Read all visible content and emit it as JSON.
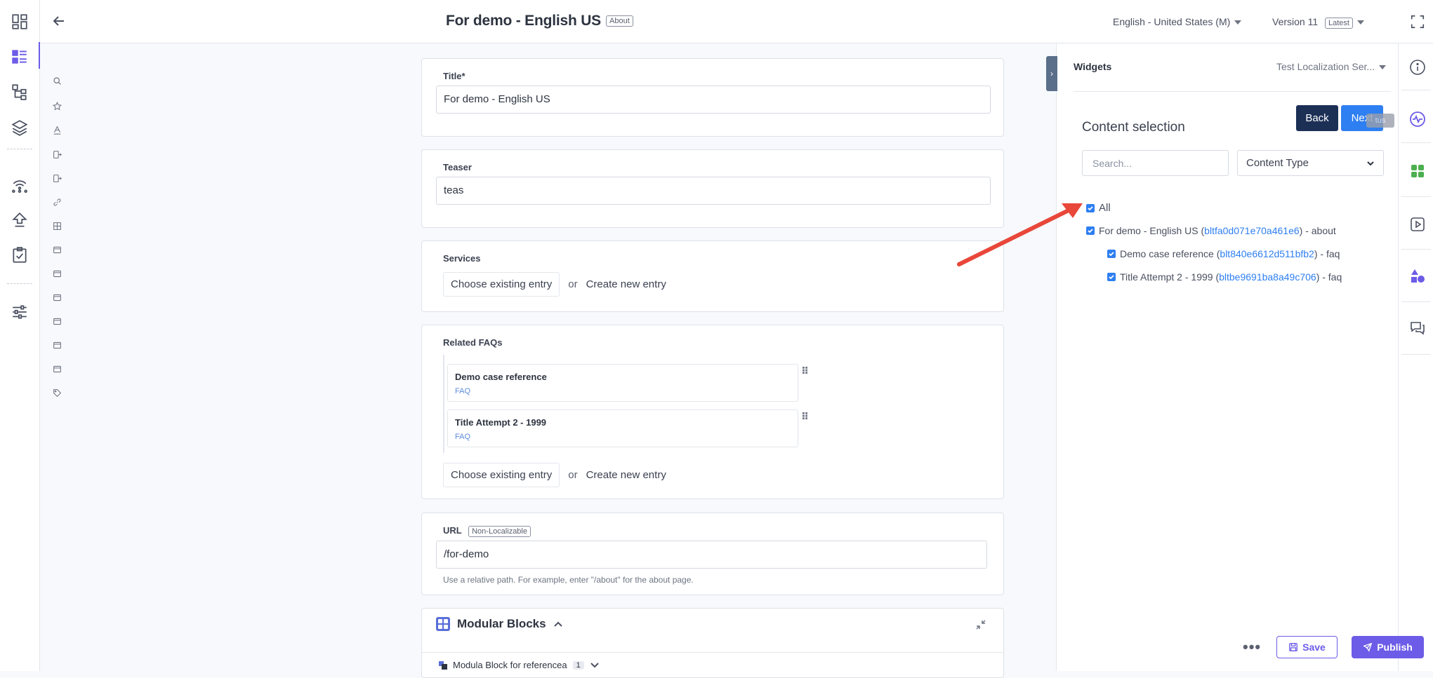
{
  "header": {
    "title": "For demo - English US",
    "title_badge": "About",
    "locale": "English - United States (M)",
    "version": "Version 11",
    "version_badge": "Latest"
  },
  "form": {
    "title": {
      "label": "Title*",
      "value": "For demo - English US"
    },
    "teaser": {
      "label": "Teaser",
      "value": "teas"
    },
    "services": {
      "label": "Services",
      "choose": "Choose existing entry",
      "or": "or",
      "create": "Create new entry"
    },
    "related_faqs": {
      "label": "Related FAQs",
      "items": [
        {
          "title": "Demo case reference",
          "type": "FAQ"
        },
        {
          "title": "Title Attempt 2 - 1999",
          "type": "FAQ"
        }
      ],
      "choose": "Choose existing entry",
      "or": "or",
      "create": "Create new entry"
    },
    "url": {
      "label": "URL",
      "badge": "Non-Localizable",
      "value": "/for-demo",
      "help": "Use a relative path. For example, enter \"/about\" for the about page."
    },
    "modular_blocks": {
      "label": "Modular Blocks",
      "block_name": "Modula Block for referencea",
      "block_count": "1"
    }
  },
  "side_panel": {
    "widgets_title": "Widgets",
    "widget_select": "Test Localization Ser...",
    "content_selection_title": "Content selection",
    "back": "Back",
    "next": "Next",
    "status_tooltip": "tus",
    "search_placeholder": "Search...",
    "content_type": "Content Type",
    "all_label": "All",
    "tree": [
      {
        "prefix": "For demo - English US (",
        "uid": "bltfa0d071e70a461e6",
        "suffix": ") - about"
      },
      {
        "prefix": "Demo case reference (",
        "uid": "blt840e6612d511bfb2",
        "suffix": ") - faq"
      },
      {
        "prefix": "Title Attempt 2 - 1999 (",
        "uid": "bltbe9691ba8a49c706",
        "suffix": ") - faq"
      }
    ]
  },
  "footer": {
    "save": "Save",
    "publish": "Publish",
    "more": "•••"
  },
  "colors": {
    "accent": "#6c5ce7",
    "link": "#2e7ff1",
    "back_button": "#1c3056",
    "arrow": "#e8473a"
  }
}
